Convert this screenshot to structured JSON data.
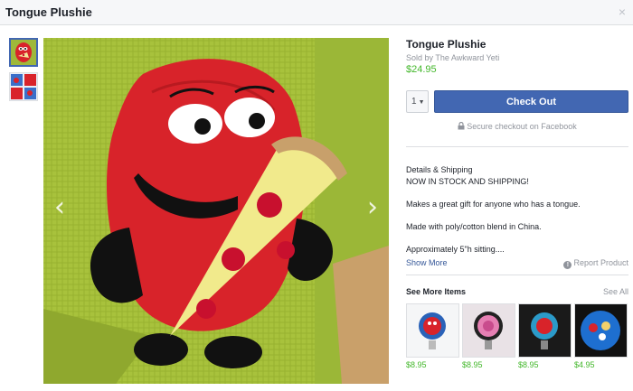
{
  "window": {
    "title": "Tongue Plushie",
    "close_glyph": "×"
  },
  "gallery": {
    "thumbnails": [
      "plushie-photo",
      "plushie-collage"
    ],
    "selected_index": 0,
    "prev_glyph": "‹",
    "next_glyph": "›"
  },
  "product": {
    "title": "Tongue Plushie",
    "seller": "Sold by The Awkward Yeti",
    "price": "$24.95"
  },
  "checkout": {
    "quantity": "1",
    "button_label": "Check Out",
    "secure_text": "Secure checkout on Facebook"
  },
  "details": {
    "heading": "Details & Shipping",
    "lines": [
      "NOW IN STOCK AND SHIPPING!",
      "Makes a great gift for anyone who has a tongue.",
      "Made with poly/cotton blend in China.",
      "Approximately 5\"h sitting...."
    ],
    "show_more": "Show More",
    "report": "Report Product"
  },
  "more_items": {
    "heading": "See More Items",
    "see_all": "See All",
    "items": [
      {
        "price": "$8.95"
      },
      {
        "price": "$8.95"
      },
      {
        "price": "$8.95"
      },
      {
        "price": "$4.95"
      }
    ]
  },
  "colors": {
    "accent": "#4267b2",
    "price_green": "#42b72a",
    "link_blue": "#365899",
    "muted": "#90949c"
  }
}
